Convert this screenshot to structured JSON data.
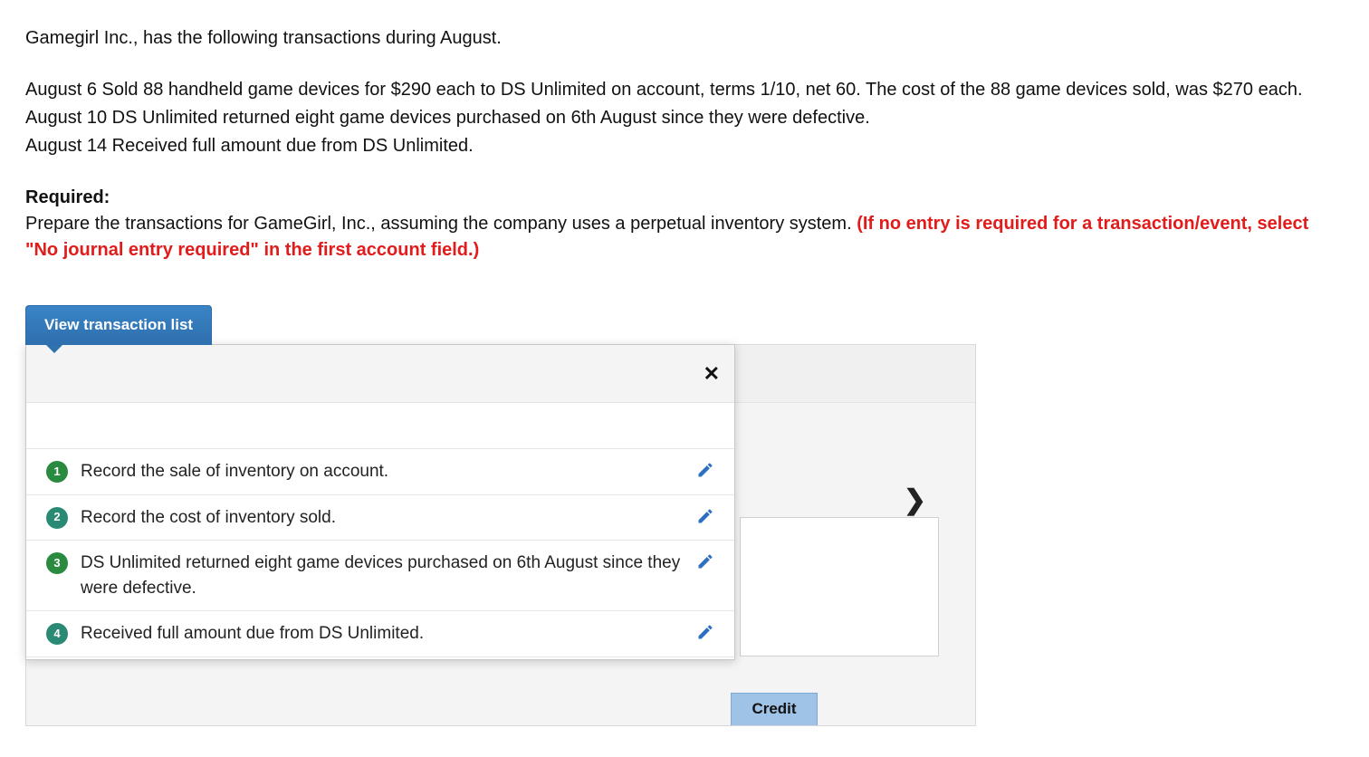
{
  "problem": {
    "intro": "Gamegirl Inc., has the following transactions during August.",
    "line1": "August 6 Sold 88 handheld game devices for $290 each to DS Unlimited on account, terms 1/10, net 60. The cost of the 88 game devices sold, was $270 each.",
    "line2": "August 10 DS Unlimited returned eight game devices purchased on 6th August since they were defective.",
    "line3": "August 14 Received full amount due from DS Unlimited.",
    "required_label": "Required:",
    "required_text_plain": "Prepare the transactions for GameGirl, Inc., assuming the company uses a perpetual inventory system. ",
    "required_text_red": "(If no entry is required for a transaction/event, select \"No journal entry required\" in the first account field.)"
  },
  "widget": {
    "view_button": "View transaction list",
    "close_glyph": "✕",
    "next_glyph": "❯",
    "credit_label": "Credit",
    "transactions": [
      {
        "num": "1",
        "badge_color": "green",
        "label": "Record the sale of inventory on account."
      },
      {
        "num": "2",
        "badge_color": "teal",
        "label": "Record the cost of inventory sold."
      },
      {
        "num": "3",
        "badge_color": "green",
        "label": "DS Unlimited returned eight game devices purchased on 6th August since they were defective."
      },
      {
        "num": "4",
        "badge_color": "teal",
        "label": "Received full amount due from DS Unlimited."
      }
    ]
  }
}
